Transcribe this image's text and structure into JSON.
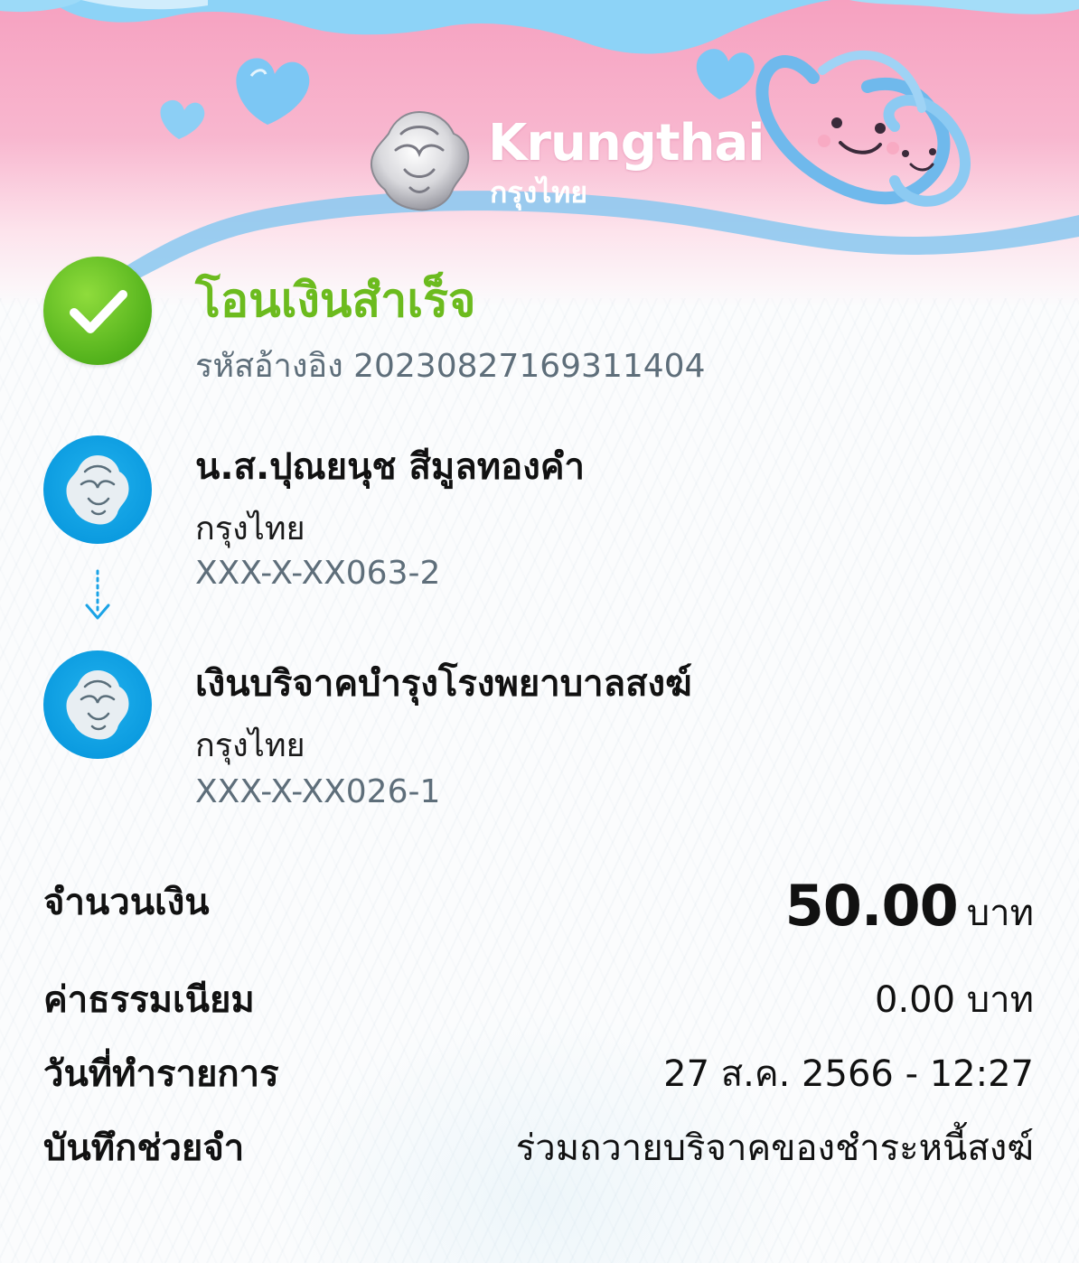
{
  "brand": {
    "name_en": "Krungthai",
    "name_th": "กรุงไทย"
  },
  "status": {
    "title": "โอนเงินสำเร็จ",
    "reference": "รหัสอ้างอิง 20230827169311404"
  },
  "sender": {
    "name": "น.ส.ปุณยนุช สีมูลทองคำ",
    "bank": "กรุงไทย",
    "account": "XXX-X-XX063-2"
  },
  "receiver": {
    "name": "เงินบริจาคบำรุงโรงพยาบาลสงฆ์",
    "bank": "กรุงไทย",
    "account": "XXX-X-XX026-1"
  },
  "details": {
    "amount_label": "จำนวนเงิน",
    "amount_value": "50.00",
    "amount_unit": "บาท",
    "fee_label": "ค่าธรรมเนียม",
    "fee_value": "0.00 บาท",
    "date_label": "วันที่ทำรายการ",
    "date_value": "27 ส.ค. 2566 - 12:27",
    "memo_label": "บันทึกช่วยจำ",
    "memo_value": "ร่วมถวายบริจาคของชำระหนี้สงฆ์"
  },
  "colors": {
    "success_green": "#6cbb1e",
    "bank_blue": "#0a9adf",
    "header_pink": "#f6a1c0",
    "header_sky": "#7ecbf5"
  }
}
